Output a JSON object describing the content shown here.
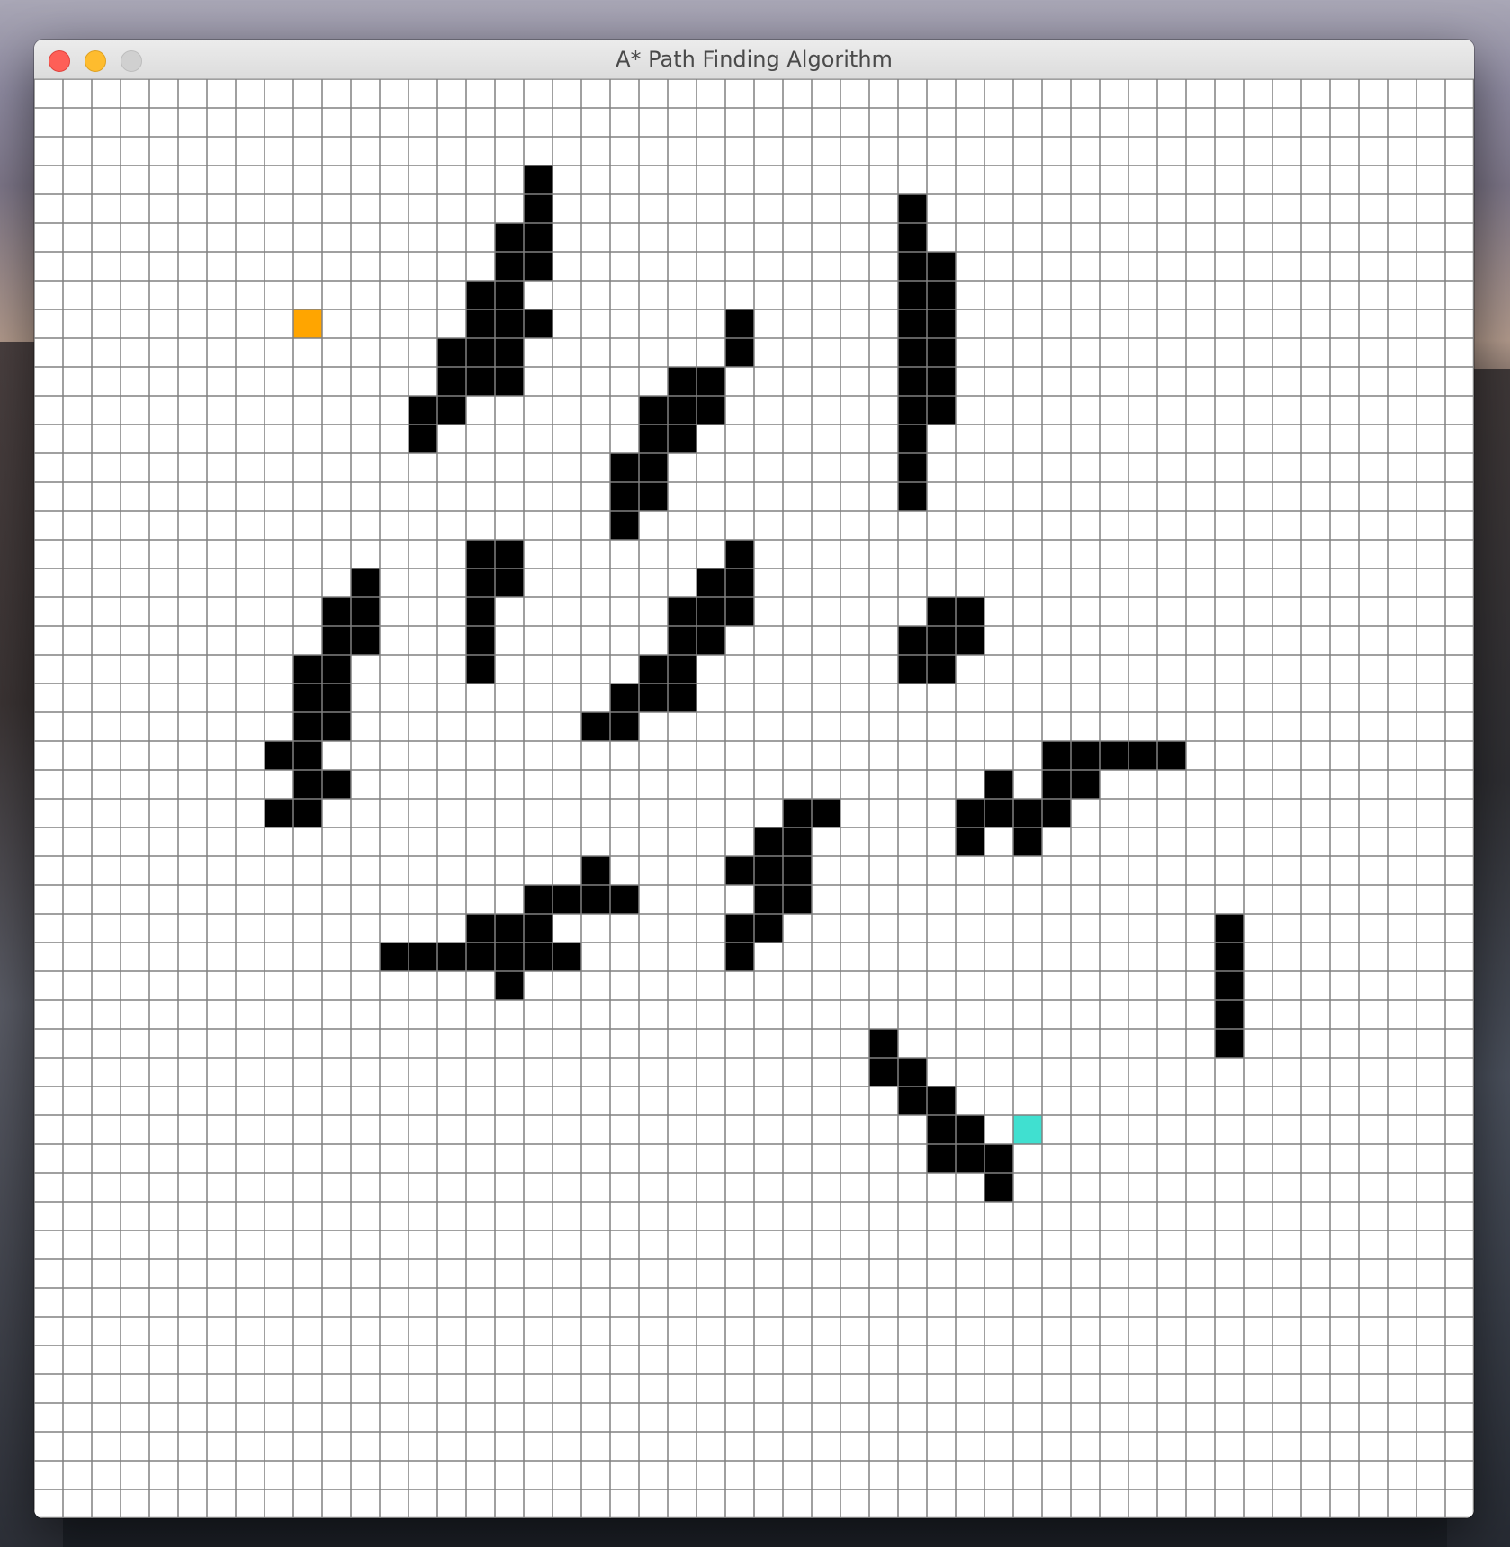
{
  "window": {
    "title": "A* Path Finding Algorithm",
    "controls": [
      "close",
      "minimize",
      "zoom"
    ]
  },
  "grid": {
    "rows": 50,
    "cols": 50,
    "colors": {
      "empty": "#ffffff",
      "gridline": "#808080",
      "barrier": "#000000",
      "start": "#ffa500",
      "end": "#40e0d0"
    },
    "start": [
      9,
      8
    ],
    "end": [
      34,
      36
    ],
    "barriers": [
      [
        17,
        3
      ],
      [
        17,
        4
      ],
      [
        16,
        5
      ],
      [
        17,
        5
      ],
      [
        16,
        6
      ],
      [
        17,
        6
      ],
      [
        15,
        7
      ],
      [
        16,
        7
      ],
      [
        15,
        8
      ],
      [
        16,
        8
      ],
      [
        17,
        8
      ],
      [
        14,
        9
      ],
      [
        15,
        9
      ],
      [
        16,
        9
      ],
      [
        14,
        10
      ],
      [
        15,
        10
      ],
      [
        16,
        10
      ],
      [
        13,
        11
      ],
      [
        14,
        11
      ],
      [
        13,
        12
      ],
      [
        24,
        8
      ],
      [
        24,
        9
      ],
      [
        22,
        10
      ],
      [
        23,
        10
      ],
      [
        21,
        11
      ],
      [
        22,
        11
      ],
      [
        23,
        11
      ],
      [
        21,
        12
      ],
      [
        22,
        12
      ],
      [
        20,
        13
      ],
      [
        21,
        13
      ],
      [
        20,
        14
      ],
      [
        21,
        14
      ],
      [
        20,
        15
      ],
      [
        30,
        4
      ],
      [
        30,
        5
      ],
      [
        30,
        6
      ],
      [
        31,
        6
      ],
      [
        30,
        7
      ],
      [
        31,
        7
      ],
      [
        30,
        8
      ],
      [
        31,
        8
      ],
      [
        30,
        9
      ],
      [
        31,
        9
      ],
      [
        30,
        10
      ],
      [
        31,
        10
      ],
      [
        30,
        11
      ],
      [
        31,
        11
      ],
      [
        30,
        12
      ],
      [
        30,
        13
      ],
      [
        30,
        14
      ],
      [
        11,
        17
      ],
      [
        10,
        18
      ],
      [
        11,
        18
      ],
      [
        10,
        19
      ],
      [
        11,
        19
      ],
      [
        9,
        20
      ],
      [
        10,
        20
      ],
      [
        9,
        21
      ],
      [
        10,
        21
      ],
      [
        9,
        22
      ],
      [
        10,
        22
      ],
      [
        8,
        23
      ],
      [
        9,
        23
      ],
      [
        9,
        24
      ],
      [
        10,
        24
      ],
      [
        8,
        25
      ],
      [
        9,
        25
      ],
      [
        15,
        16
      ],
      [
        16,
        16
      ],
      [
        15,
        17
      ],
      [
        16,
        17
      ],
      [
        15,
        18
      ],
      [
        15,
        19
      ],
      [
        15,
        20
      ],
      [
        24,
        16
      ],
      [
        23,
        17
      ],
      [
        24,
        17
      ],
      [
        22,
        18
      ],
      [
        23,
        18
      ],
      [
        24,
        18
      ],
      [
        22,
        19
      ],
      [
        23,
        19
      ],
      [
        21,
        20
      ],
      [
        22,
        20
      ],
      [
        20,
        21
      ],
      [
        21,
        21
      ],
      [
        22,
        21
      ],
      [
        19,
        22
      ],
      [
        20,
        22
      ],
      [
        31,
        18
      ],
      [
        32,
        18
      ],
      [
        30,
        19
      ],
      [
        31,
        19
      ],
      [
        32,
        19
      ],
      [
        30,
        20
      ],
      [
        31,
        20
      ],
      [
        35,
        23
      ],
      [
        36,
        23
      ],
      [
        37,
        23
      ],
      [
        38,
        23
      ],
      [
        39,
        23
      ],
      [
        33,
        24
      ],
      [
        35,
        24
      ],
      [
        36,
        24
      ],
      [
        32,
        25
      ],
      [
        33,
        25
      ],
      [
        34,
        25
      ],
      [
        35,
        25
      ],
      [
        32,
        26
      ],
      [
        34,
        26
      ],
      [
        26,
        25
      ],
      [
        27,
        25
      ],
      [
        25,
        26
      ],
      [
        26,
        26
      ],
      [
        24,
        27
      ],
      [
        25,
        27
      ],
      [
        26,
        27
      ],
      [
        25,
        28
      ],
      [
        26,
        28
      ],
      [
        24,
        29
      ],
      [
        25,
        29
      ],
      [
        24,
        30
      ],
      [
        19,
        27
      ],
      [
        17,
        28
      ],
      [
        18,
        28
      ],
      [
        19,
        28
      ],
      [
        20,
        28
      ],
      [
        15,
        29
      ],
      [
        16,
        29
      ],
      [
        17,
        29
      ],
      [
        12,
        30
      ],
      [
        13,
        30
      ],
      [
        14,
        30
      ],
      [
        15,
        30
      ],
      [
        16,
        30
      ],
      [
        17,
        30
      ],
      [
        18,
        30
      ],
      [
        16,
        31
      ],
      [
        41,
        29
      ],
      [
        41,
        30
      ],
      [
        41,
        31
      ],
      [
        41,
        32
      ],
      [
        41,
        33
      ],
      [
        29,
        33
      ],
      [
        29,
        34
      ],
      [
        30,
        34
      ],
      [
        30,
        35
      ],
      [
        31,
        35
      ],
      [
        31,
        36
      ],
      [
        32,
        36
      ],
      [
        31,
        37
      ],
      [
        32,
        37
      ],
      [
        33,
        37
      ],
      [
        33,
        38
      ]
    ]
  }
}
